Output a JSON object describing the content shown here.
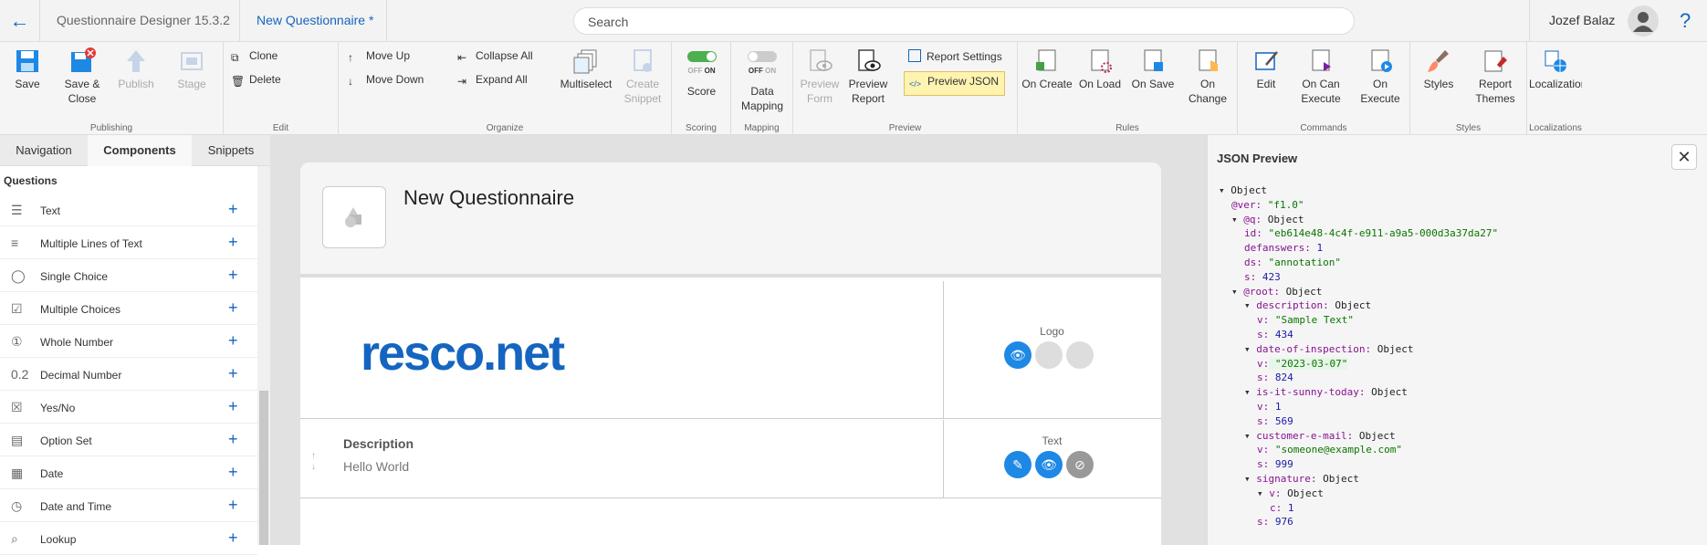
{
  "header": {
    "app_name": "Questionnaire Designer 15.3.2",
    "doc_tab": "New Questionnaire *",
    "search_placeholder": "Search",
    "user_name": "Jozef Balaz",
    "help": "?"
  },
  "ribbon": {
    "publishing": {
      "label": "Publishing",
      "save": "Save",
      "save_close": "Save & Close",
      "publish": "Publish",
      "stage": "Stage"
    },
    "edit": {
      "label": "Edit",
      "clone": "Clone",
      "delete": "Delete"
    },
    "organize": {
      "label": "Organize",
      "move_up": "Move Up",
      "move_down": "Move Down",
      "collapse_all": "Collapse All",
      "expand_all": "Expand All",
      "multiselect": "Multiselect",
      "create_snippet": "Create Snippet"
    },
    "scoring": {
      "label": "Scoring",
      "score": "Score",
      "toggle_off": "OFF",
      "toggle_on": "ON"
    },
    "mapping": {
      "label": "Mapping",
      "data_mapping": "Data Mapping",
      "toggle_off": "OFF",
      "toggle_on": "ON"
    },
    "preview": {
      "label": "Preview",
      "preview_form": "Preview Form",
      "preview_report": "Preview Report",
      "report_settings": "Report Settings",
      "preview_json": "Preview JSON"
    },
    "rules": {
      "label": "Rules",
      "on_create": "On Create",
      "on_load": "On Load",
      "on_save": "On Save",
      "on_change": "On Change"
    },
    "commands": {
      "label": "Commands",
      "edit": "Edit",
      "on_can_execute": "On Can Execute",
      "on_execute": "On Execute"
    },
    "styles": {
      "label": "Styles",
      "styles": "Styles",
      "report_themes": "Report Themes"
    },
    "localizations": {
      "label": "Localizations",
      "localization": "Localization"
    }
  },
  "left_panel": {
    "tabs": [
      "Navigation",
      "Components",
      "Snippets"
    ],
    "section": "Questions",
    "items": [
      {
        "label": "Text",
        "icon": "text-lines-icon"
      },
      {
        "label": "Multiple Lines of Text",
        "icon": "multiline-icon"
      },
      {
        "label": "Single Choice",
        "icon": "radio-icon"
      },
      {
        "label": "Multiple Choices",
        "icon": "checkbox-icon"
      },
      {
        "label": "Whole Number",
        "icon": "number-1-icon"
      },
      {
        "label": "Decimal Number",
        "icon": "decimal-icon"
      },
      {
        "label": "Yes/No",
        "icon": "yes-no-icon"
      },
      {
        "label": "Option Set",
        "icon": "option-set-icon"
      },
      {
        "label": "Date",
        "icon": "calendar-icon"
      },
      {
        "label": "Date and Time",
        "icon": "clock-icon"
      },
      {
        "label": "Lookup",
        "icon": "search-icon"
      }
    ],
    "add_symbol": "+"
  },
  "canvas": {
    "title": "New Questionnaire",
    "logo_text": "resco.net",
    "logo_label": "Logo",
    "description_label": "Description",
    "description_value": "Hello World",
    "text_label": "Text"
  },
  "json_panel": {
    "title": "JSON Preview",
    "close": "✕",
    "lines": [
      {
        "t": "▾ ",
        "k": "Object",
        "v": "",
        "cls": ""
      },
      {
        "t": "",
        "k": "@ver:",
        "v": " \"f1.0\"",
        "cls": "str"
      },
      {
        "t": "▾ ",
        "k": "@q:",
        "v": " Object",
        "cls": "o"
      },
      {
        "t": "",
        "k": "id:",
        "v": " \"eb614e48-4c4f-e911-a9a5-000d3a37da27\"",
        "cls": "str"
      },
      {
        "t": "",
        "k": "defanswers:",
        "v": " 1",
        "cls": "num"
      },
      {
        "t": "",
        "k": "ds:",
        "v": " \"annotation\"",
        "cls": "str"
      },
      {
        "t": "",
        "k": "s:",
        "v": " 423",
        "cls": "num"
      },
      {
        "t": "▾ ",
        "k": "@root:",
        "v": " Object",
        "cls": "o"
      },
      {
        "t": "▾ ",
        "k": "description:",
        "v": " Object",
        "cls": "o"
      },
      {
        "t": "",
        "k": "v:",
        "v": " \"Sample Text\"",
        "cls": "str"
      },
      {
        "t": "",
        "k": "s:",
        "v": " 434",
        "cls": "num"
      },
      {
        "t": "▾ ",
        "k": "date-of-inspection:",
        "v": " Object",
        "cls": "o"
      },
      {
        "t": "",
        "k": "v:",
        "v": " \"2023-03-07\"",
        "cls": "str"
      },
      {
        "t": "",
        "k": "s:",
        "v": " 824",
        "cls": "num"
      },
      {
        "t": "▾ ",
        "k": "is-it-sunny-today:",
        "v": " Object",
        "cls": "o"
      },
      {
        "t": "",
        "k": "v:",
        "v": " 1",
        "cls": "num"
      },
      {
        "t": "",
        "k": "s:",
        "v": " 569",
        "cls": "num"
      },
      {
        "t": "▾ ",
        "k": "customer-e-mail:",
        "v": " Object",
        "cls": "o"
      },
      {
        "t": "",
        "k": "v:",
        "v": " \"someone@example.com\"",
        "cls": "str"
      },
      {
        "t": "",
        "k": "s:",
        "v": " 999",
        "cls": "num"
      },
      {
        "t": "▾ ",
        "k": "signature:",
        "v": " Object",
        "cls": "o"
      },
      {
        "t": "▾ ",
        "k": "v:",
        "v": " Object",
        "cls": "o"
      },
      {
        "t": "",
        "k": "c:",
        "v": " 1",
        "cls": "num"
      },
      {
        "t": "",
        "k": "s:",
        "v": " 976",
        "cls": "num"
      }
    ]
  },
  "colors": {
    "accent": "#1565c0",
    "active_button": "#fff3b0",
    "toggle_on": "#4caf50"
  }
}
